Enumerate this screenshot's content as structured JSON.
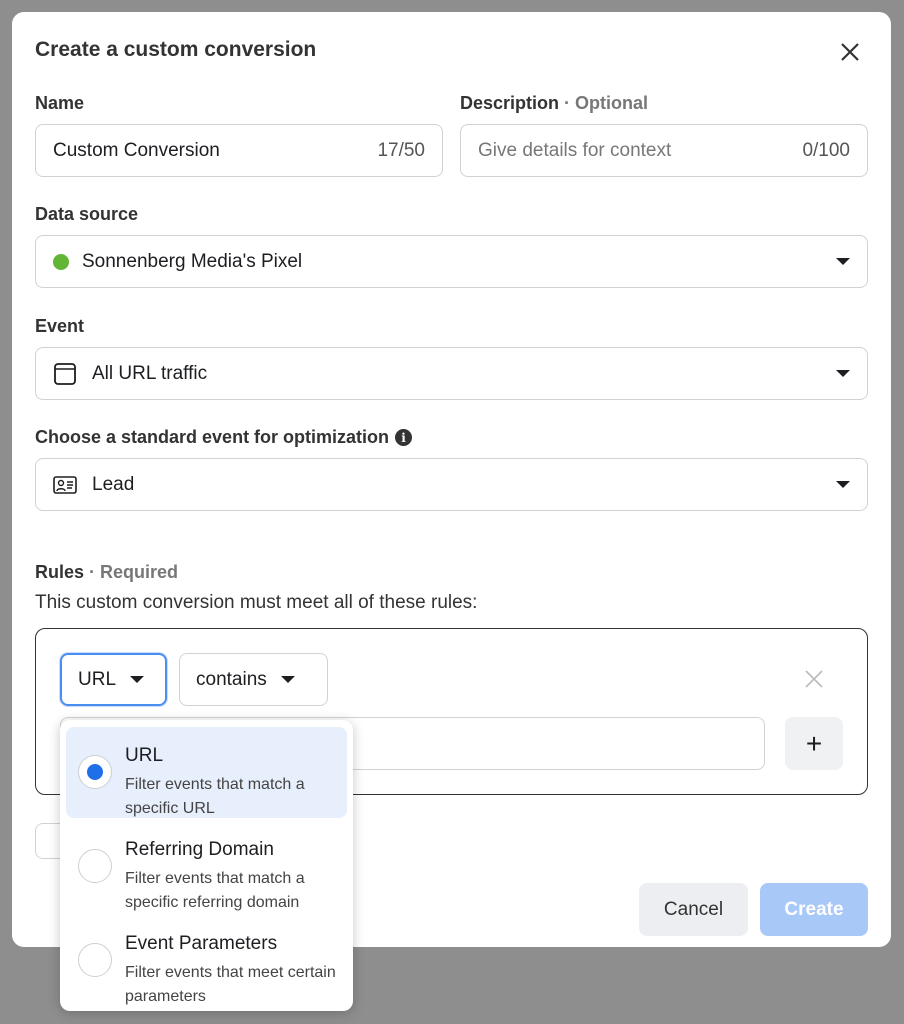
{
  "dialog": {
    "title": "Create a custom conversion",
    "close_icon": "close-icon"
  },
  "name": {
    "label": "Name",
    "value": "Custom Conversion",
    "count": "17/50"
  },
  "description": {
    "label": "Description",
    "optional": "· Optional",
    "placeholder": "Give details for context",
    "count": "0/100"
  },
  "data_source": {
    "label": "Data source",
    "value": "Sonnenberg Media's Pixel",
    "status_color": "#63b536"
  },
  "event": {
    "label": "Event",
    "value": "All URL traffic",
    "icon": "browser-window-icon"
  },
  "standard_event": {
    "label": "Choose a standard event for optimization",
    "value": "Lead",
    "icon": "contact-card-icon",
    "info_icon": "info-icon"
  },
  "rules": {
    "label": "Rules",
    "required": "· Required",
    "subtitle": "This custom conversion must meet all of these rules:",
    "field": "URL",
    "operator": "contains",
    "value": ""
  },
  "dropdown": {
    "options": [
      {
        "title": "URL",
        "description": "Filter events that match a specific URL",
        "selected": true
      },
      {
        "title": "Referring Domain",
        "description": "Filter events that match a specific referring domain",
        "selected": false
      },
      {
        "title": "Event Parameters",
        "description": "Filter events that meet certain parameters",
        "selected": false
      }
    ]
  },
  "footer": {
    "cancel": "Cancel",
    "create": "Create"
  },
  "colors": {
    "accent": "#1f6fe8",
    "create_disabled": "#a8c8f8"
  }
}
